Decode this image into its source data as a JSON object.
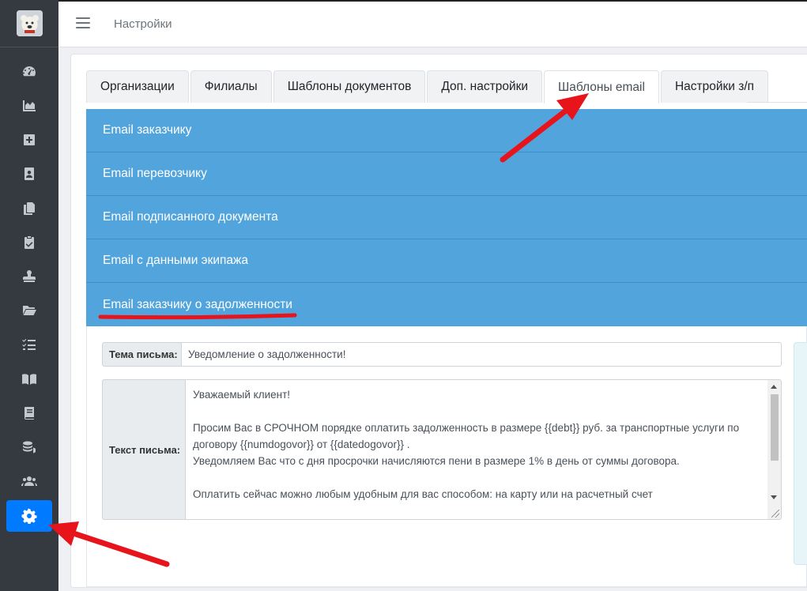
{
  "header": {
    "page_title": "Настройки"
  },
  "sidebar": {
    "items": [
      {
        "icon": "speedometer-icon"
      },
      {
        "icon": "area-chart-icon"
      },
      {
        "icon": "plus-square-icon"
      },
      {
        "icon": "contact-card-icon"
      },
      {
        "icon": "copy-documents-icon"
      },
      {
        "icon": "clipboard-check-icon"
      },
      {
        "icon": "stamp-icon"
      },
      {
        "icon": "folder-open-icon"
      },
      {
        "icon": "task-list-icon"
      },
      {
        "icon": "book-open-icon"
      },
      {
        "icon": "book-icon"
      },
      {
        "icon": "coins-icon"
      },
      {
        "icon": "users-icon"
      },
      {
        "icon": "gear-icon",
        "active": true
      }
    ]
  },
  "tabs": [
    {
      "label": "Организации"
    },
    {
      "label": "Филиалы"
    },
    {
      "label": "Шаблоны документов"
    },
    {
      "label": "Доп. настройки"
    },
    {
      "label": "Шаблоны email",
      "active": true
    },
    {
      "label": "Настройки з/п"
    }
  ],
  "accordion": [
    {
      "title": "Email заказчику"
    },
    {
      "title": "Email перевозчику"
    },
    {
      "title": "Email подписанного документа"
    },
    {
      "title": "Email с данными экипажа"
    },
    {
      "title": "Email заказчику о задолженности",
      "expanded": true
    }
  ],
  "form": {
    "subject_label": "Тема письма:",
    "subject_value": "Уведомление о задолженности!",
    "body_label": "Текст письма:",
    "body_lines": [
      "Уважаемый клиент!",
      "",
      "Просим Вас в СРОЧНОМ порядке оплатить задолженность в размере {{debt}} руб. за транспортные услуги по",
      "договору {{numdogovor}} от {{datedogovor}} .",
      "Уведомляем Вас что с дня просрочки начисляются пени в размере 1% в день от суммы договора.",
      "",
      "Оплатить сейчас можно любым удобным для вас способом: на карту или на расчетный счет"
    ]
  },
  "colors": {
    "sidebar_bg": "#343a40",
    "active_nav": "#007bff",
    "accordion_bg": "#52a4dd",
    "annotation_red": "#e8141c"
  }
}
